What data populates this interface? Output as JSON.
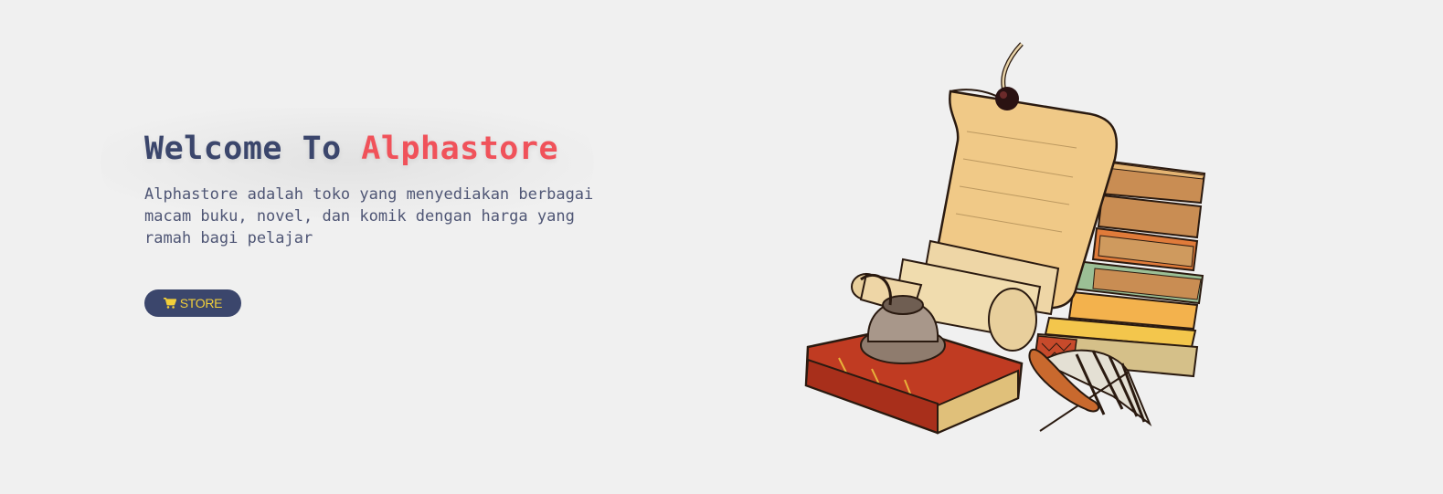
{
  "hero": {
    "title_prefix": "Welcome To",
    "title_brand": "Alphastore",
    "description": "Alphastore adalah toko yang menyediakan berbagai macam buku, novel, dan komik dengan harga yang ramah bagi pelajar",
    "store_button_label": "STORE",
    "store_button_icon": "shopping-cart-icon"
  },
  "colors": {
    "background": "#f0f0f0",
    "navy": "#3b466c",
    "brand_red": "#f0525a",
    "button_text": "#f2cf3a"
  }
}
